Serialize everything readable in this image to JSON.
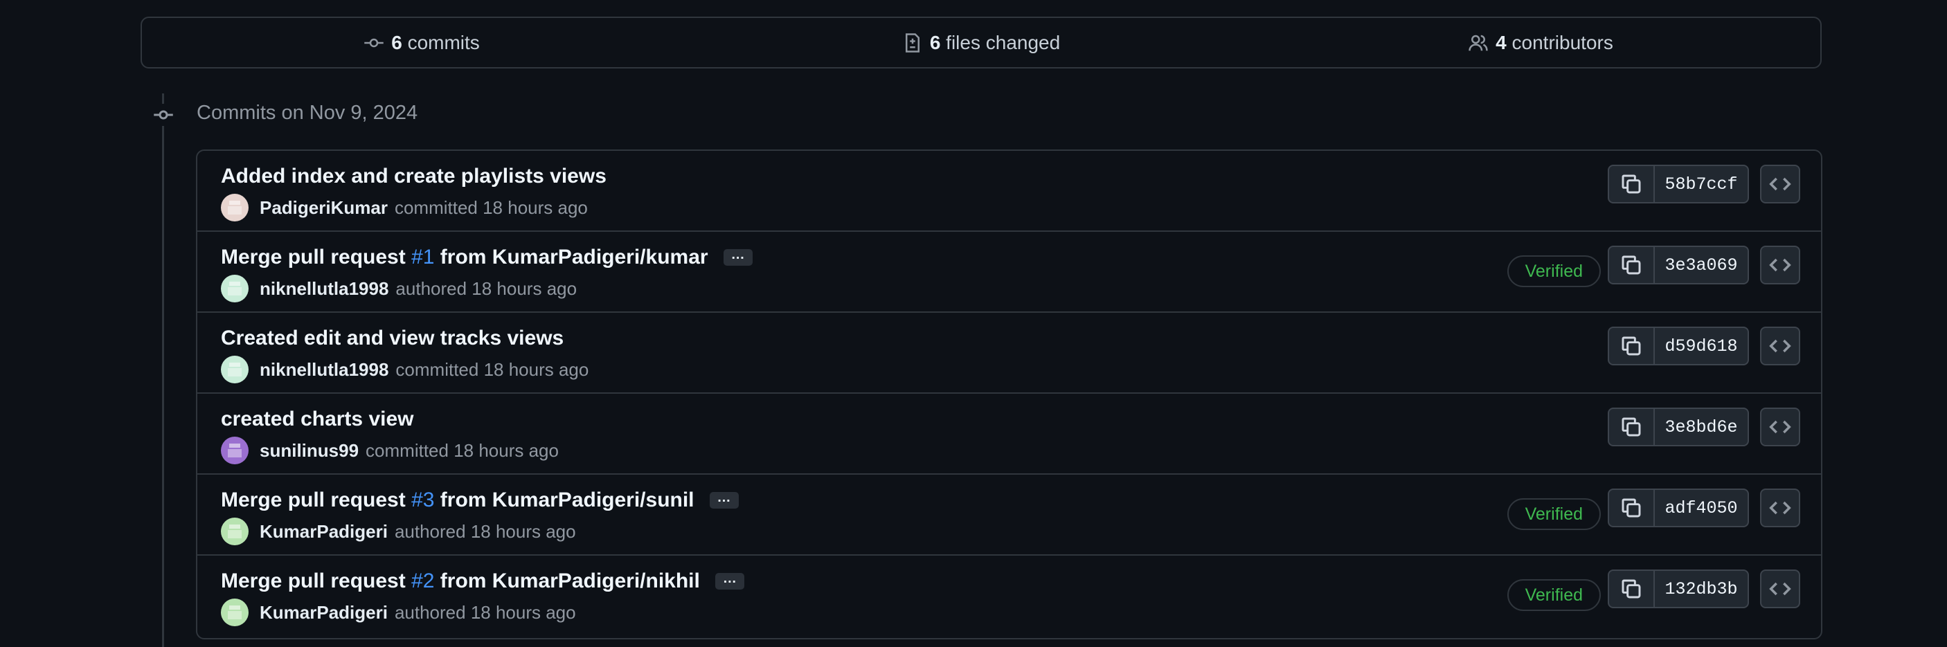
{
  "summary": {
    "commits_count": "6",
    "commits_label": "commits",
    "files_count": "6",
    "files_label": "files changed",
    "contributors_count": "4",
    "contributors_label": "contributors"
  },
  "timeline": {
    "date_label": "Commits on Nov 9, 2024"
  },
  "commits": [
    {
      "title": "Added index and create playlists views",
      "author": "PadigeriKumar",
      "action": "committed 18 hours ago",
      "sha": "58b7ccf",
      "verified": false,
      "avatar_color": "#e8d5d0"
    },
    {
      "title_prefix": "Merge pull request ",
      "pr": "#1",
      "title_suffix": " from KumarPadigeri/kumar",
      "author": "niknellutla1998",
      "action": "authored 18 hours ago",
      "sha": "3e3a069",
      "verified": true,
      "verified_label": "Verified",
      "avatar_color": "#c8ecd8"
    },
    {
      "title": "Created edit and view tracks views",
      "author": "niknellutla1998",
      "action": "committed 18 hours ago",
      "sha": "d59d618",
      "verified": false,
      "avatar_color": "#c8ecd8"
    },
    {
      "title": "created charts view",
      "author": "sunilinus99",
      "action": "committed 18 hours ago",
      "sha": "3e8bd6e",
      "verified": false,
      "avatar_color": "#9b6fd0"
    },
    {
      "title_prefix": "Merge pull request ",
      "pr": "#3",
      "title_suffix": " from KumarPadigeri/sunil",
      "author": "KumarPadigeri",
      "action": "authored 18 hours ago",
      "sha": "adf4050",
      "verified": true,
      "verified_label": "Verified",
      "avatar_color": "#b7e3b0"
    },
    {
      "title_prefix": "Merge pull request ",
      "pr": "#2",
      "title_suffix": " from KumarPadigeri/nikhil",
      "author": "KumarPadigeri",
      "action": "authored 18 hours ago",
      "sha": "132db3b",
      "verified": true,
      "verified_label": "Verified",
      "avatar_color": "#b7e3b0"
    }
  ],
  "ellipsis_label": "…",
  "icons": {
    "commit": "git-commit-icon",
    "files": "file-diff-icon",
    "contributors": "people-icon",
    "copy": "copy-icon",
    "browse": "code-icon"
  },
  "colors": {
    "verified": "#3fb950",
    "link": "#4493f8",
    "background": "#0d1117"
  }
}
